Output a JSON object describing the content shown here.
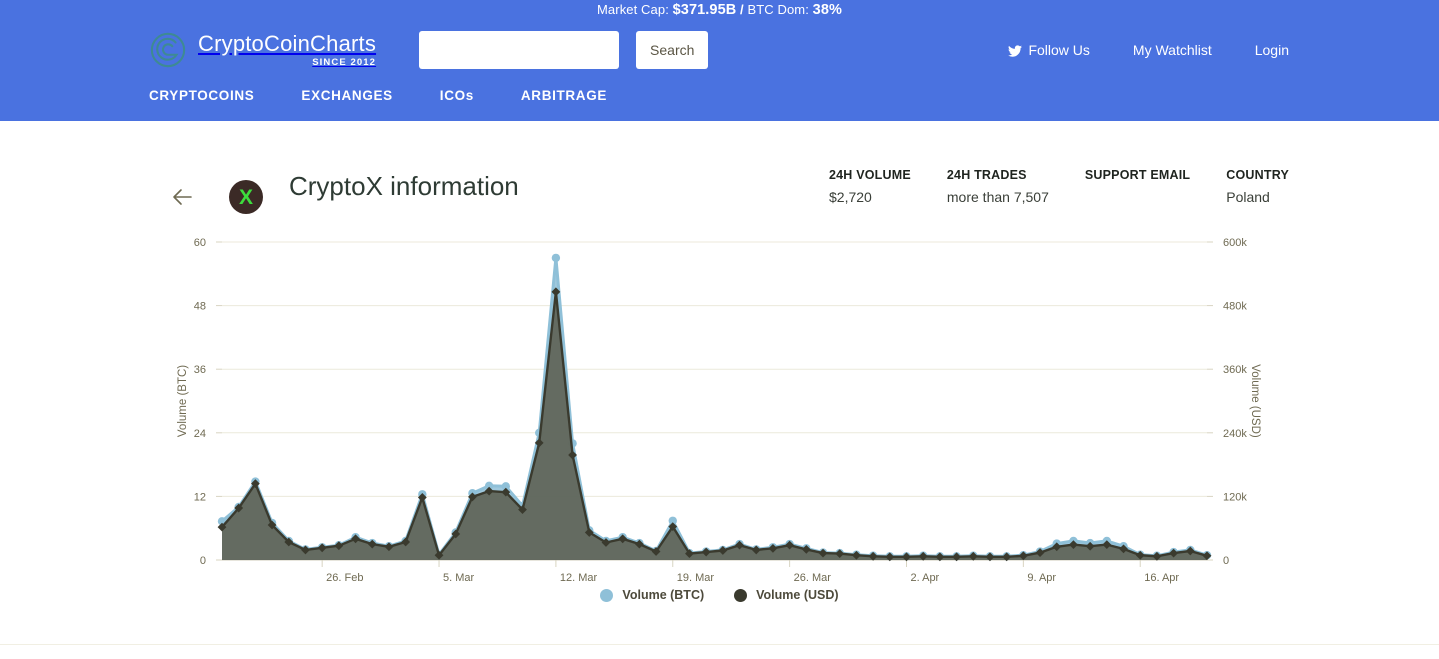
{
  "ticker": {
    "market_cap_label": "Market Cap:",
    "market_cap_value": "$371.95B",
    "separator": "/",
    "btc_dom_label": "BTC Dom:",
    "btc_dom_value": "38%"
  },
  "brand": {
    "name": "CryptoCoinCharts",
    "since": "SINCE 2012",
    "logo_icon": "spiral-coin-icon"
  },
  "search": {
    "value": "",
    "placeholder": "",
    "button_label": "Search"
  },
  "header_links": [
    {
      "label": "Follow Us",
      "icon": "twitter-icon"
    },
    {
      "label": "My Watchlist",
      "icon": ""
    },
    {
      "label": "Login",
      "icon": ""
    }
  ],
  "nav": [
    {
      "label": "CRYPTOCOINS"
    },
    {
      "label": "EXCHANGES"
    },
    {
      "label": "ICOs"
    },
    {
      "label": "ARBITRAGE"
    }
  ],
  "page": {
    "back_icon": "arrow-left-icon",
    "coin_symbol": "X",
    "title": "CryptoX information"
  },
  "stats": [
    {
      "label": "24H VOLUME",
      "value": "$2,720"
    },
    {
      "label": "24H TRADES",
      "value": "more than 7,507"
    },
    {
      "label": "SUPPORT EMAIL",
      "value": ""
    },
    {
      "label": "COUNTRY",
      "value": "Poland"
    }
  ],
  "colors": {
    "header_blue": "#4a72e0",
    "btc_series": "#8fc0d8",
    "usd_series": "#3a3a2e",
    "area_fill": "#5e6356",
    "grid": "#eceadb",
    "axis_text": "#6f6a52",
    "coin_logo_bg": "#3b2a26",
    "coin_logo_fg": "#3ddd3d"
  },
  "chart_data": {
    "type": "area",
    "title": "",
    "xlabel": "",
    "ylabel": "Volume (BTC)",
    "y2label": "Volume (USD)",
    "ylim": [
      0,
      60
    ],
    "yticks": [
      0,
      12,
      24,
      36,
      48,
      60
    ],
    "ytick_labels": [
      "0",
      "12",
      "24",
      "36",
      "48",
      "60"
    ],
    "y2lim": [
      0,
      600000
    ],
    "y2ticks": [
      0,
      120000,
      240000,
      360000,
      480000,
      600000
    ],
    "y2tick_labels": [
      "0",
      "120k",
      "240k",
      "360k",
      "480k",
      "600k"
    ],
    "grid": true,
    "legend_position": "bottom",
    "xtick_labels": [
      "26. Feb",
      "5. Mar",
      "12. Mar",
      "19. Mar",
      "26. Mar",
      "2. Apr",
      "9. Apr",
      "16. Apr"
    ],
    "xtick_indices": [
      6,
      13,
      20,
      27,
      34,
      41,
      48,
      55
    ],
    "x": [
      "20. Feb",
      "21. Feb",
      "22. Feb",
      "23. Feb",
      "24. Feb",
      "25. Feb",
      "26. Feb",
      "27. Feb",
      "28. Feb",
      "1. Mar",
      "2. Mar",
      "3. Mar",
      "4. Mar",
      "5. Mar",
      "6. Mar",
      "7. Mar",
      "8. Mar",
      "9. Mar",
      "10. Mar",
      "11. Mar",
      "12. Mar",
      "13. Mar",
      "14. Mar",
      "15. Mar",
      "16. Mar",
      "17. Mar",
      "18. Mar",
      "19. Mar",
      "20. Mar",
      "21. Mar",
      "22. Mar",
      "23. Mar",
      "24. Mar",
      "25. Mar",
      "26. Mar",
      "27. Mar",
      "28. Mar",
      "29. Mar",
      "30. Mar",
      "31. Mar",
      "1. Apr",
      "2. Apr",
      "3. Apr",
      "4. Apr",
      "5. Apr",
      "6. Apr",
      "7. Apr",
      "8. Apr",
      "9. Apr",
      "10. Apr",
      "11. Apr",
      "12. Apr",
      "13. Apr",
      "14. Apr",
      "15. Apr",
      "16. Apr",
      "17. Apr",
      "18. Apr",
      "19. Apr",
      "20. Apr"
    ],
    "series": [
      {
        "name": "Volume (BTC)",
        "color": "#8fc0d8",
        "values": [
          7.3,
          10.0,
          14.8,
          7.0,
          3.6,
          2.0,
          2.4,
          2.8,
          4.3,
          3.2,
          2.6,
          3.6,
          12.4,
          1.0,
          5.2,
          12.6,
          14.0,
          13.9,
          10.2,
          24.0,
          57.0,
          22.0,
          5.6,
          3.6,
          4.3,
          3.2,
          1.7,
          7.4,
          1.3,
          1.6,
          1.9,
          3.0,
          2.0,
          2.4,
          3.0,
          2.2,
          1.4,
          1.3,
          1.0,
          0.8,
          0.7,
          0.7,
          0.8,
          0.7,
          0.7,
          0.8,
          0.7,
          0.7,
          0.9,
          1.6,
          3.1,
          3.6,
          3.2,
          3.6,
          2.6,
          1.0,
          0.8,
          1.5,
          1.9,
          0.9
        ]
      },
      {
        "name": "Volume (USD)",
        "color": "#3a3a2e",
        "values": [
          62000,
          98000,
          144000,
          66000,
          34000,
          19000,
          23000,
          27000,
          40000,
          30000,
          25000,
          34000,
          118000,
          9000,
          49000,
          119000,
          130000,
          128000,
          95000,
          221000,
          506000,
          198000,
          52000,
          33000,
          40000,
          30000,
          16000,
          63000,
          12000,
          15000,
          18000,
          28000,
          19000,
          22000,
          28000,
          20000,
          13000,
          12000,
          9000,
          7000,
          6000,
          6000,
          7000,
          6000,
          6000,
          7000,
          6000,
          6000,
          8000,
          14000,
          25000,
          29000,
          26000,
          29000,
          21000,
          9000,
          7000,
          13000,
          17000,
          8000
        ]
      }
    ]
  },
  "legend": [
    {
      "label": "Volume (BTC)",
      "color": "#8fc0d8"
    },
    {
      "label": "Volume (USD)",
      "color": "#3a3a2e"
    }
  ]
}
